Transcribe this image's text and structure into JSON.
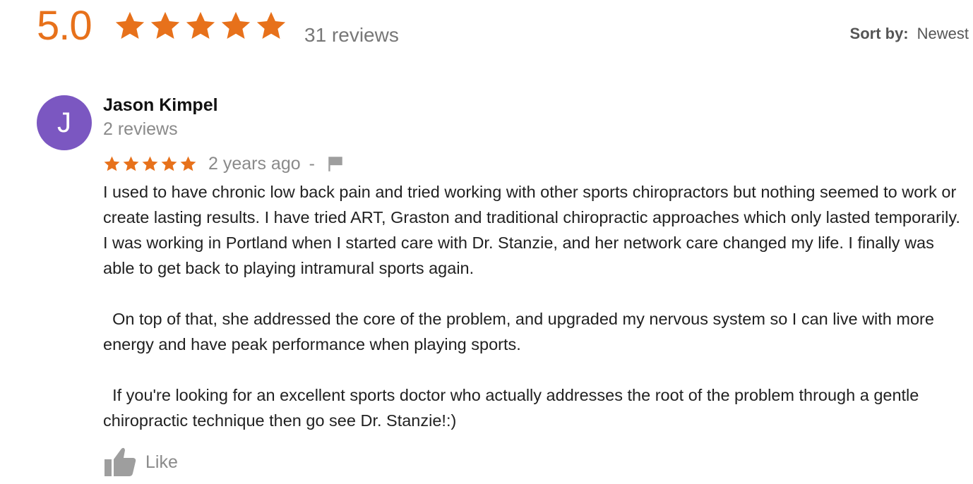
{
  "summary": {
    "rating": "5.0",
    "stars": 5,
    "review_count": "31 reviews",
    "star_color": "#e7711b"
  },
  "sort": {
    "label": "Sort by:",
    "value": "Newest"
  },
  "review": {
    "avatar_letter": "J",
    "avatar_color": "#7b57c1",
    "author": "Jason Kimpel",
    "author_reviews": "2 reviews",
    "stars": 5,
    "date": "2 years ago",
    "separator": "-",
    "flag_icon": "flag-icon",
    "paragraphs": [
      "I used to have chronic low back pain and tried working with other sports chiropractors but nothing seemed to work or create lasting results.  I have tried ART, Graston and traditional chiropractic approaches which only lasted temporarily. I was working in Portland when I started care with Dr. Stanzie, and her network care changed my life. I finally was able to get back to playing intramural sports again.",
      "  On top of that, she addressed the core of the problem, and upgraded my nervous system so I can live with more energy and have peak performance when playing sports.",
      "  If you're looking for an excellent sports doctor who actually addresses the root of the problem through a gentle chiropractic technique then go see Dr. Stanzie!:)"
    ],
    "like_label": "Like",
    "like_icon": "thumbs-up-icon"
  }
}
